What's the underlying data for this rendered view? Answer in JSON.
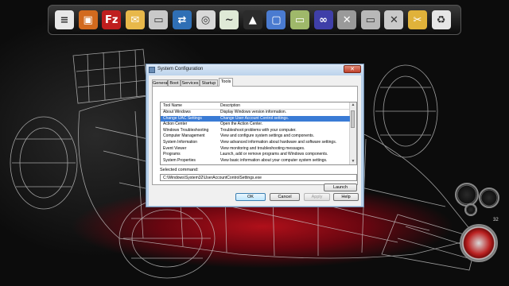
{
  "dock": {
    "icons": [
      {
        "name": "notepad-icon",
        "color": "#e8e8e8",
        "glyph": "≡"
      },
      {
        "name": "visual-studio-icon",
        "color": "#d26a1e",
        "glyph": "▣"
      },
      {
        "name": "filezilla-icon",
        "color": "#bf1e1e",
        "glyph": "Fz"
      },
      {
        "name": "outlook-icon",
        "color": "#e8b84a",
        "glyph": "✉"
      },
      {
        "name": "folder-icon",
        "color": "#c9c9c9",
        "glyph": "▭"
      },
      {
        "name": "teamviewer-icon",
        "color": "#2f6fb5",
        "glyph": "⇄"
      },
      {
        "name": "lifebuoy-icon",
        "color": "#d8d8d8",
        "glyph": "◎"
      },
      {
        "name": "gadget-icon",
        "color": "#dfe9d6",
        "glyph": "~"
      },
      {
        "name": "vlc-icon",
        "color": "#2b2b2b",
        "glyph": "▲"
      },
      {
        "name": "monitor-icon",
        "color": "#4a7bd0",
        "glyph": "▢"
      },
      {
        "name": "network-folder-icon",
        "color": "#9fb86a",
        "glyph": "▭"
      },
      {
        "name": "infinity-icon",
        "color": "#3f3fa8",
        "glyph": "∞"
      },
      {
        "name": "tools-icon",
        "color": "#9a9a9a",
        "glyph": "✕"
      },
      {
        "name": "documents-folder-icon",
        "color": "#b8b8b8",
        "glyph": "▭"
      },
      {
        "name": "archive-icon",
        "color": "#c9c9c9",
        "glyph": "✕"
      },
      {
        "name": "shortcut-icon",
        "color": "#e0b23a",
        "glyph": "✂"
      },
      {
        "name": "recycle-bin-icon",
        "color": "#e6e6e6",
        "glyph": "♻"
      }
    ]
  },
  "window": {
    "title": "System Configuration",
    "close_glyph": "✕",
    "tabs": [
      "General",
      "Boot",
      "Services",
      "Startup",
      "Tools"
    ],
    "active_tab": "Tools",
    "columns": [
      "Tool Name",
      "Description"
    ],
    "rows": [
      [
        "About Windows",
        "Display Windows version information."
      ],
      [
        "Change UAC Settings",
        "Change User Account Control settings."
      ],
      [
        "Action Center",
        "Open the Action Center."
      ],
      [
        "Windows Troubleshooting",
        "Troubleshoot problems with your computer."
      ],
      [
        "Computer Management",
        "View and configure system settings and components."
      ],
      [
        "System Information",
        "View advanced information about hardware and software settings."
      ],
      [
        "Event Viewer",
        "View monitoring and troubleshooting messages."
      ],
      [
        "Programs",
        "Launch, add or remove programs and Windows components."
      ],
      [
        "System Properties",
        "View basic information about your computer system settings."
      ]
    ],
    "selected_row": 1,
    "selected_command_label": "Selected command:",
    "selected_command": "C:\\Windows\\System32\\UserAccountControlSettings.exe",
    "launch_label": "Launch",
    "ok_label": "OK",
    "cancel_label": "Cancel",
    "apply_label": "Apply",
    "help_label": "Help"
  },
  "gadgets": {
    "clock_number": "32"
  }
}
